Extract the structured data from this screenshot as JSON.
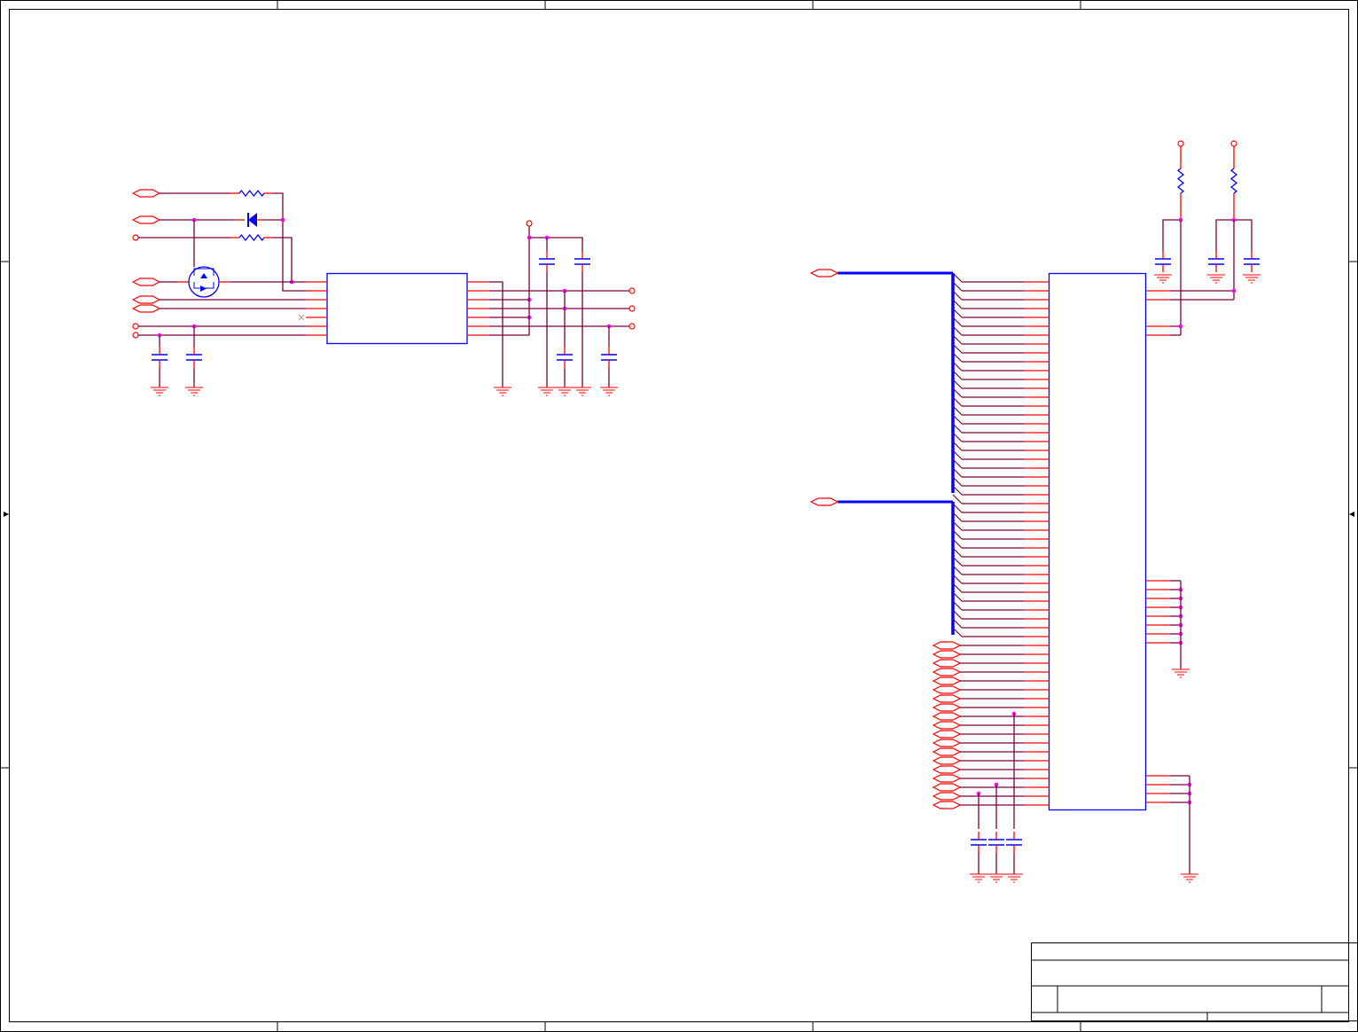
{
  "colors": {
    "wire": "#7a0040",
    "pin": "#ff0000",
    "component": "#0000ff",
    "junction": "#ff00ff",
    "frame": "#000000",
    "ground": "#ff3030"
  },
  "title_block": {}
}
